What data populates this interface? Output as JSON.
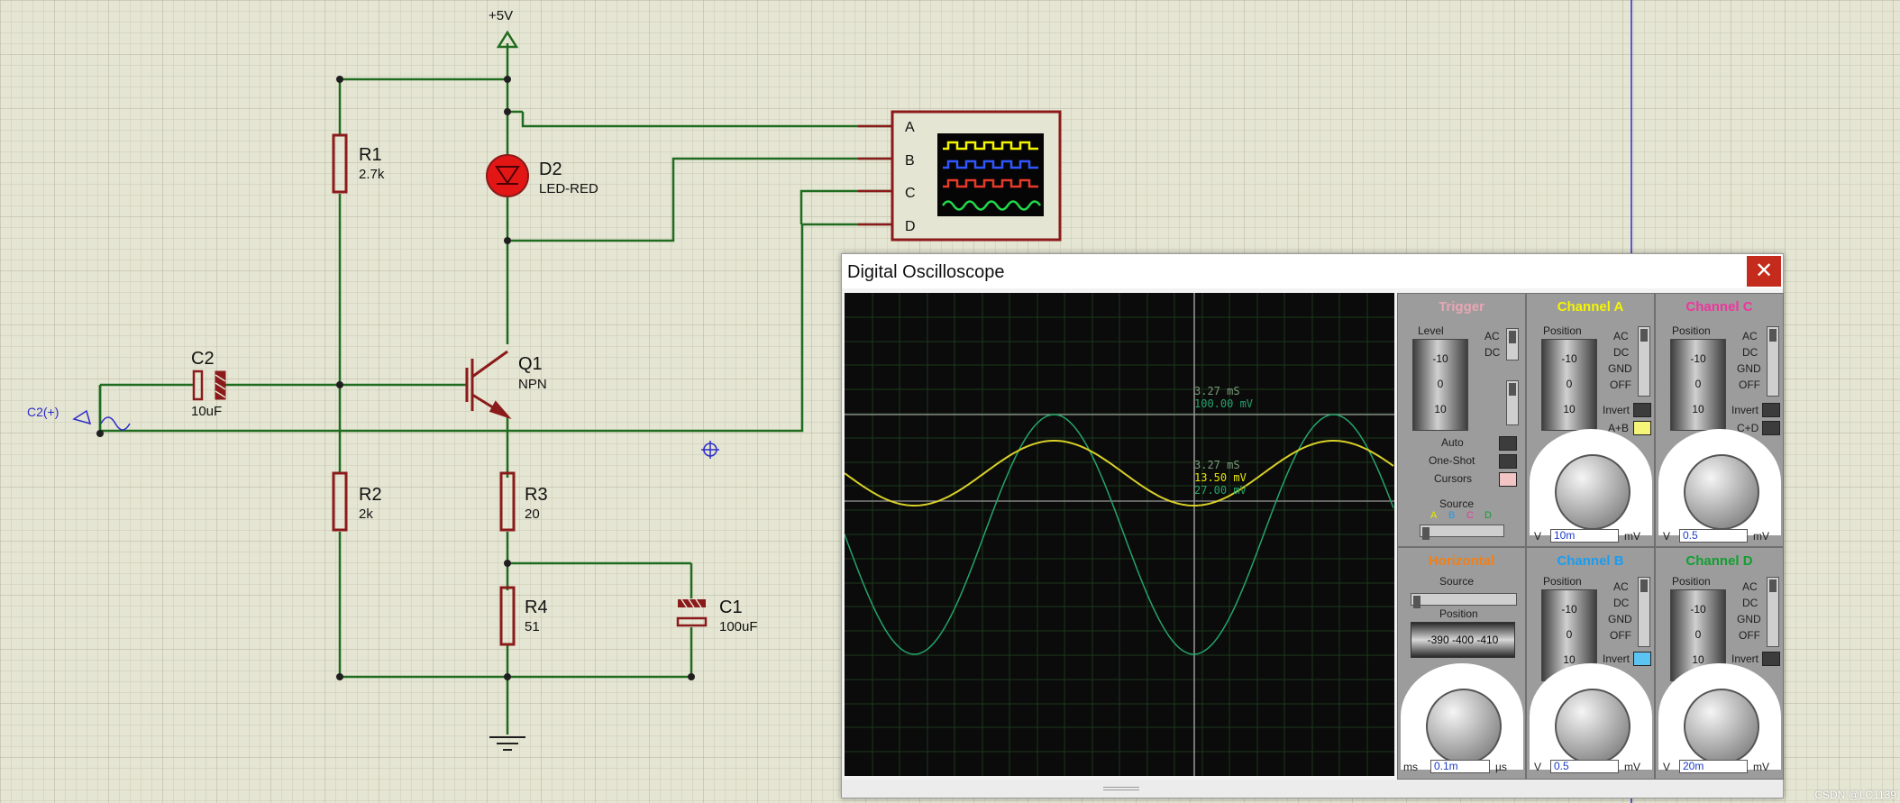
{
  "schematic": {
    "supply_label": "+5V",
    "components": [
      {
        "id": "r1",
        "ref": "R1",
        "value": "2.7k"
      },
      {
        "id": "d2",
        "ref": "D2",
        "value": "LED-RED"
      },
      {
        "id": "q1",
        "ref": "Q1",
        "value": "NPN"
      },
      {
        "id": "c2",
        "ref": "C2",
        "value": "10uF"
      },
      {
        "id": "r2",
        "ref": "R2",
        "value": "2k"
      },
      {
        "id": "r3",
        "ref": "R3",
        "value": "20"
      },
      {
        "id": "r4",
        "ref": "R4",
        "value": "51"
      },
      {
        "id": "c1",
        "ref": "C1",
        "value": "100uF"
      }
    ],
    "source_label": "C2(+)",
    "scope_inputs": [
      "A",
      "B",
      "C",
      "D"
    ]
  },
  "oscilloscope": {
    "title": "Digital Oscilloscope",
    "close_glyph": "✕",
    "readouts": {
      "cursor1_time": "3.27 mS",
      "cursor1_value": "100.00 mV",
      "cursor2_time": "3.27 mS",
      "cursor2_value_a": "13.50 mV",
      "cursor2_value_b": "27.00 mV"
    },
    "trigger": {
      "title": "Trigger",
      "level_label": "Level",
      "coupling": [
        "AC",
        "DC"
      ],
      "modes": [
        "Auto",
        "One-Shot",
        "Cursors"
      ],
      "source_label": "Source",
      "sources": [
        "A",
        "B",
        "C",
        "D"
      ]
    },
    "fader_ticks": [
      "-10",
      "0",
      "10"
    ],
    "horizontal": {
      "title": "Horizontal",
      "source_label": "Source",
      "position_label": "Position",
      "position_scale": "-390 -400 -410",
      "timebase_value": "0.1m",
      "unit_left": "ms",
      "unit_right": "µs",
      "dial_scale": [
        "0.5",
        "0.2",
        "0.1",
        "50",
        "20",
        "10",
        "5",
        "2",
        "1",
        "0.5",
        "200",
        "100",
        "50",
        "20"
      ]
    },
    "channel_a": {
      "title": "Channel A",
      "position_label": "Position",
      "coupling": [
        "AC",
        "DC",
        "GND",
        "OFF"
      ],
      "invert_label": "Invert",
      "combine_label": "A+B",
      "volts_value": "10m",
      "unit_left": "V",
      "unit_right": "mV"
    },
    "channel_b": {
      "title": "Channel B",
      "position_label": "Position",
      "coupling": [
        "AC",
        "DC",
        "GND",
        "OFF"
      ],
      "invert_label": "Invert",
      "volts_value": "0.5",
      "unit_left": "V",
      "unit_right": "mV"
    },
    "channel_c": {
      "title": "Channel C",
      "position_label": "Position",
      "coupling": [
        "AC",
        "DC",
        "GND",
        "OFF"
      ],
      "invert_label": "Invert",
      "combine_label": "C+D",
      "volts_value": "0.5",
      "unit_left": "V",
      "unit_right": "mV"
    },
    "channel_d": {
      "title": "Channel D",
      "position_label": "Position",
      "coupling": [
        "AC",
        "DC",
        "GND",
        "OFF"
      ],
      "invert_label": "Invert",
      "volts_value": "20m",
      "unit_left": "V",
      "unit_right": "mV"
    },
    "volts_dial_scale": [
      "0.5",
      "0.2",
      "0.1",
      "1",
      "50",
      "2",
      "20",
      "5",
      "10",
      "10",
      "5",
      "20",
      "2",
      "1"
    ]
  },
  "watermark": "CSDN @LC1139",
  "colors": {
    "background": "#e5e5d3",
    "grid_minor": "#c7c7b3",
    "grid_major": "#b3b39f",
    "wire": "#1f6b1f",
    "component": "#8b1a1a",
    "label": "#111111",
    "led": "#e31616",
    "trigger_title": "#e8a6b5",
    "channel_a": "#f5f500",
    "channel_b": "#1c9cf0",
    "channel_c": "#f0359e",
    "channel_d": "#10a030",
    "horizontal_title": "#f08018",
    "trace_a": "#d8d028",
    "trace_d": "#24a46a"
  }
}
